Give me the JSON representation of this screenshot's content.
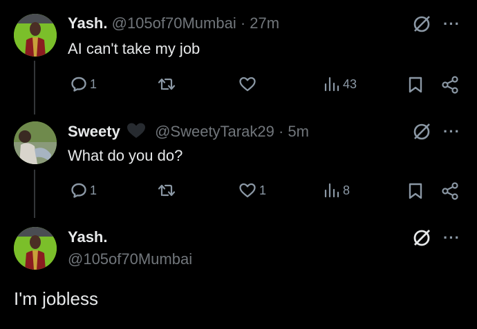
{
  "tweets": [
    {
      "name": "Yash.",
      "handle": "@105of70Mumbai",
      "time": "· 27m",
      "text": "AI can't take my job",
      "reply_count": "1",
      "retweet_count": "",
      "like_count": "",
      "views": "43",
      "avatar_color": "#7bbf2a"
    },
    {
      "name": "Sweety",
      "handle": "@SweetyTarak29",
      "time": "· 5m",
      "text": "What do you do?",
      "reply_count": "1",
      "retweet_count": "",
      "like_count": "1",
      "views": "8",
      "avatar_color": "#6f8a4c"
    }
  ],
  "main_tweet": {
    "name": "Yash.",
    "handle": "@105of70Mumbai",
    "text": "I'm jobless"
  },
  "icons": {
    "reply": "speech-bubble-icon",
    "retweet": "retweet-icon",
    "like": "heart-icon",
    "views": "bar-chart-icon",
    "bookmark": "bookmark-icon",
    "share": "share-icon",
    "grok": "grok-icon",
    "more": "more-icon"
  },
  "colors": {
    "background": "#000000",
    "text": "#e7e9ea",
    "muted": "#71767b",
    "icon": "#8b98a5"
  }
}
